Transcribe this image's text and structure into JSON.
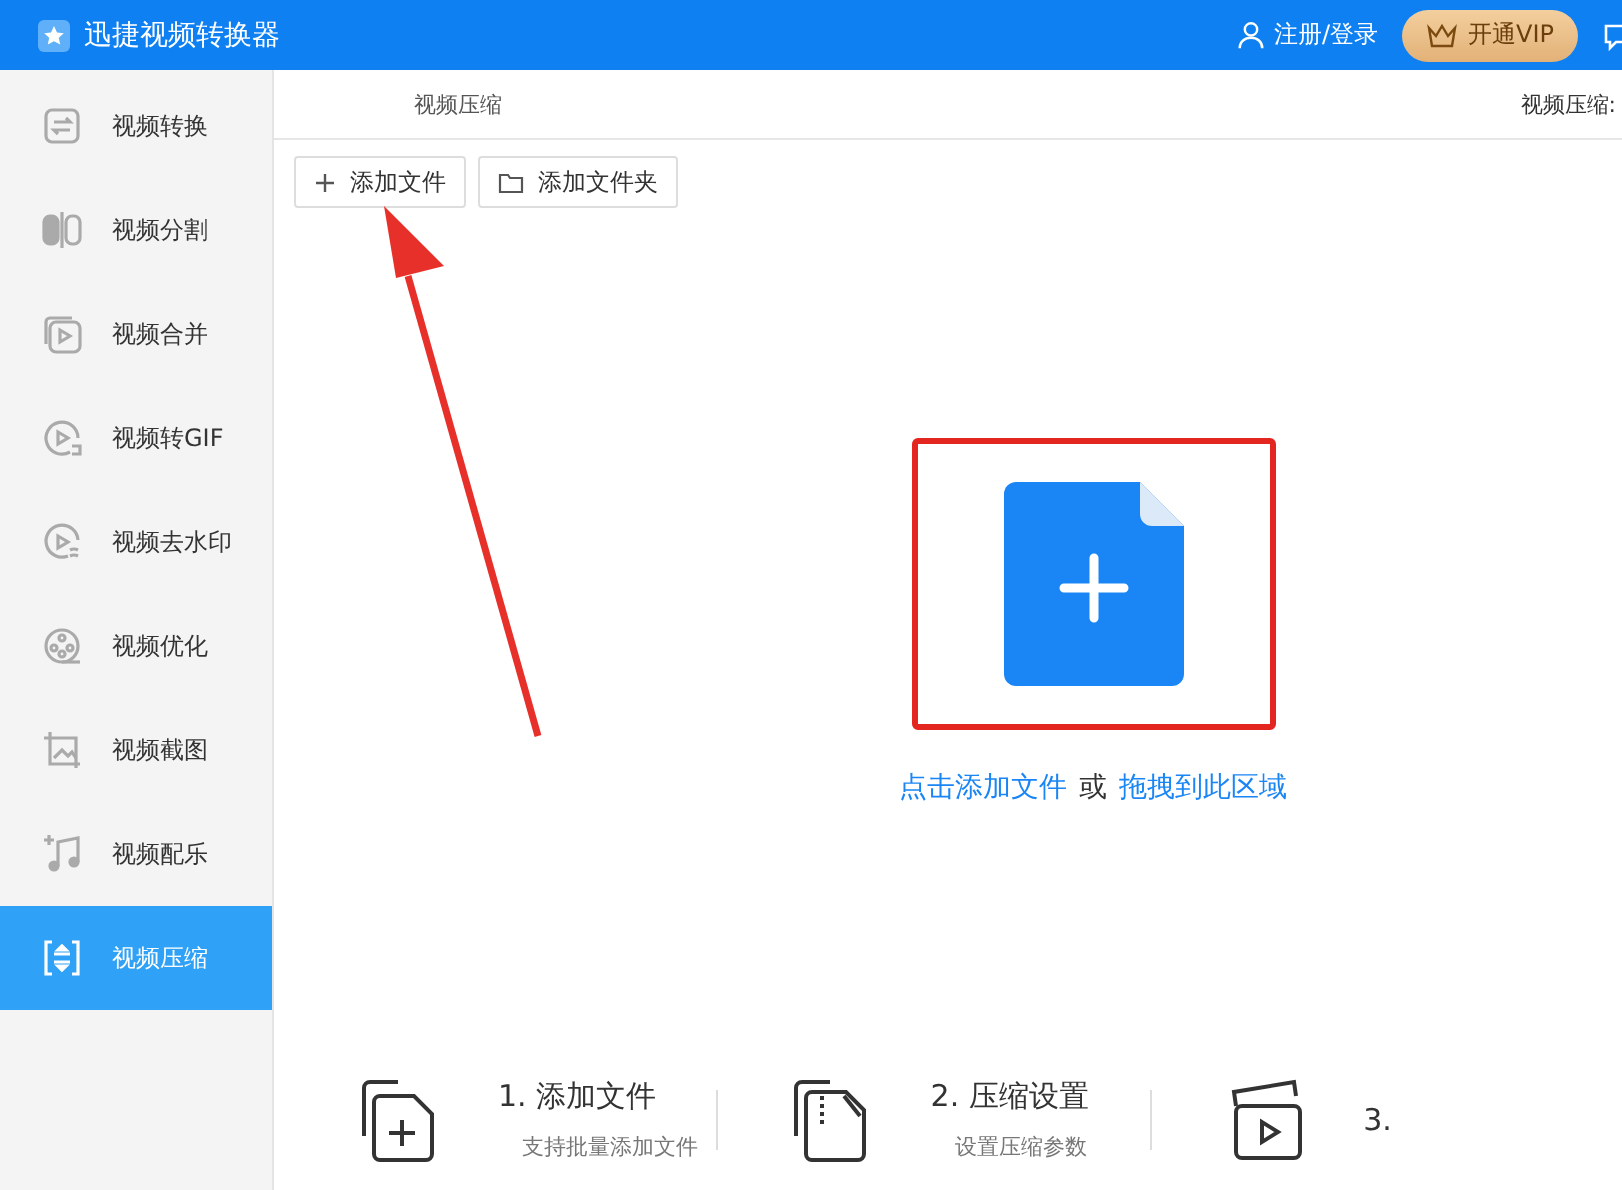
{
  "window": {
    "title": "迅捷视频转换器"
  },
  "header": {
    "login": "注册/登录",
    "vip": "开通VIP"
  },
  "sidebar": {
    "items": [
      {
        "label": "视频转换",
        "selected": false
      },
      {
        "label": "视频分割",
        "selected": false
      },
      {
        "label": "视频合并",
        "selected": false
      },
      {
        "label": "视频转GIF",
        "selected": false
      },
      {
        "label": "视频去水印",
        "selected": false
      },
      {
        "label": "视频优化",
        "selected": false
      },
      {
        "label": "视频截图",
        "selected": false
      },
      {
        "label": "视频配乐",
        "selected": false
      },
      {
        "label": "视频压缩",
        "selected": true
      }
    ]
  },
  "breadcrumb": "视频压缩",
  "right_label": "视频压缩:",
  "toolbar": [
    "添加文件",
    "添加文件夹"
  ],
  "dropzone": {
    "link": "点击添加文件",
    "or": "或",
    "drag": "拖拽到此区域"
  },
  "steps": [
    {
      "title": "1. 添加文件",
      "subtitle": "支持批量添加文件"
    },
    {
      "title": "2. 压缩设置",
      "subtitle": "设置压缩参数"
    },
    {
      "title": "3."
    }
  ]
}
